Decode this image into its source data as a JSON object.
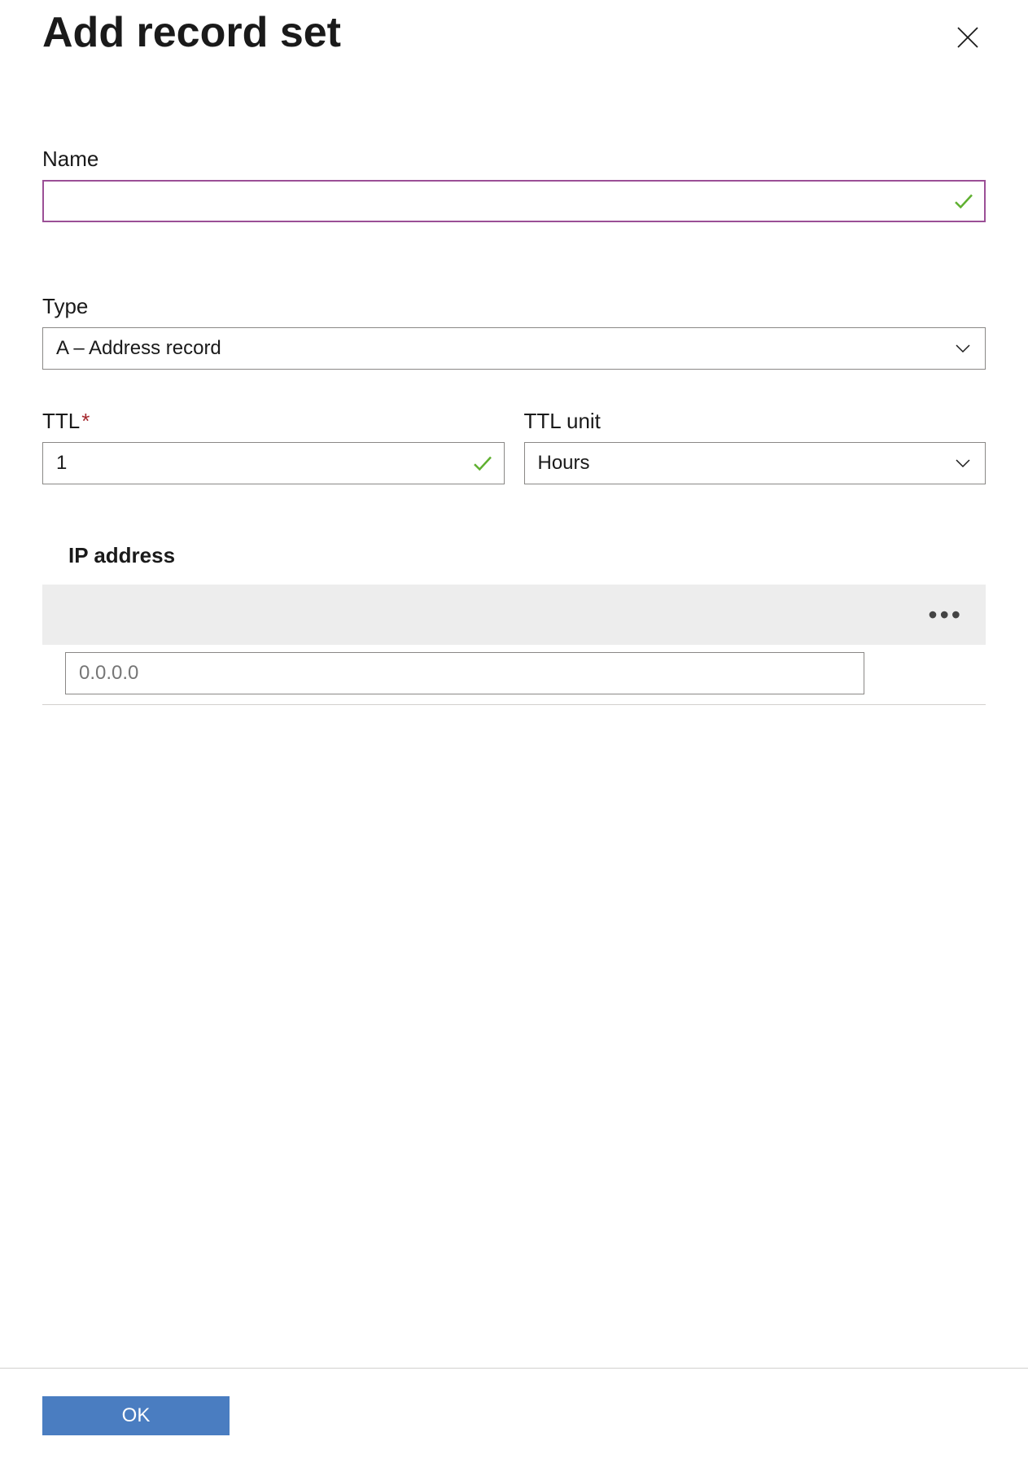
{
  "header": {
    "title": "Add record set"
  },
  "fields": {
    "name": {
      "label": "Name",
      "value": ""
    },
    "type": {
      "label": "Type",
      "selected": "A – Address record"
    },
    "ttl": {
      "label": "TTL",
      "value": "1"
    },
    "ttl_unit": {
      "label": "TTL unit",
      "selected": "Hours"
    },
    "ip_address": {
      "label": "IP address",
      "placeholder": "0.0.0.0"
    }
  },
  "footer": {
    "ok_label": "OK"
  }
}
